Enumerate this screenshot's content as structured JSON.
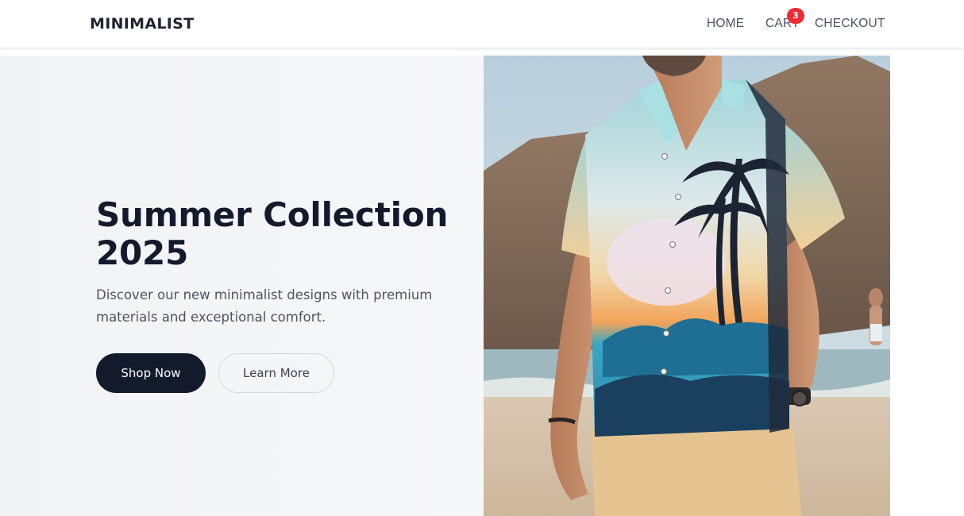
{
  "header": {
    "brand": "MINIMALIST",
    "nav": {
      "home": "HOME",
      "cart": "CART",
      "checkout": "CHECKOUT"
    },
    "cart_count": "3"
  },
  "hero": {
    "title_line1": "Summer Collection",
    "title_line2": "2025",
    "subtitle_line1": "Discover our new minimalist designs with premium",
    "subtitle_line2": "materials and exceptional comfort.",
    "primary_button": "Shop Now",
    "secondary_button": "Learn More",
    "image_subject": "man-in-tropical-print-shirt-on-beach"
  },
  "colors": {
    "primary": "#131a2b",
    "badge": "#ef2b36",
    "hero_background": "#f3f4f6"
  }
}
